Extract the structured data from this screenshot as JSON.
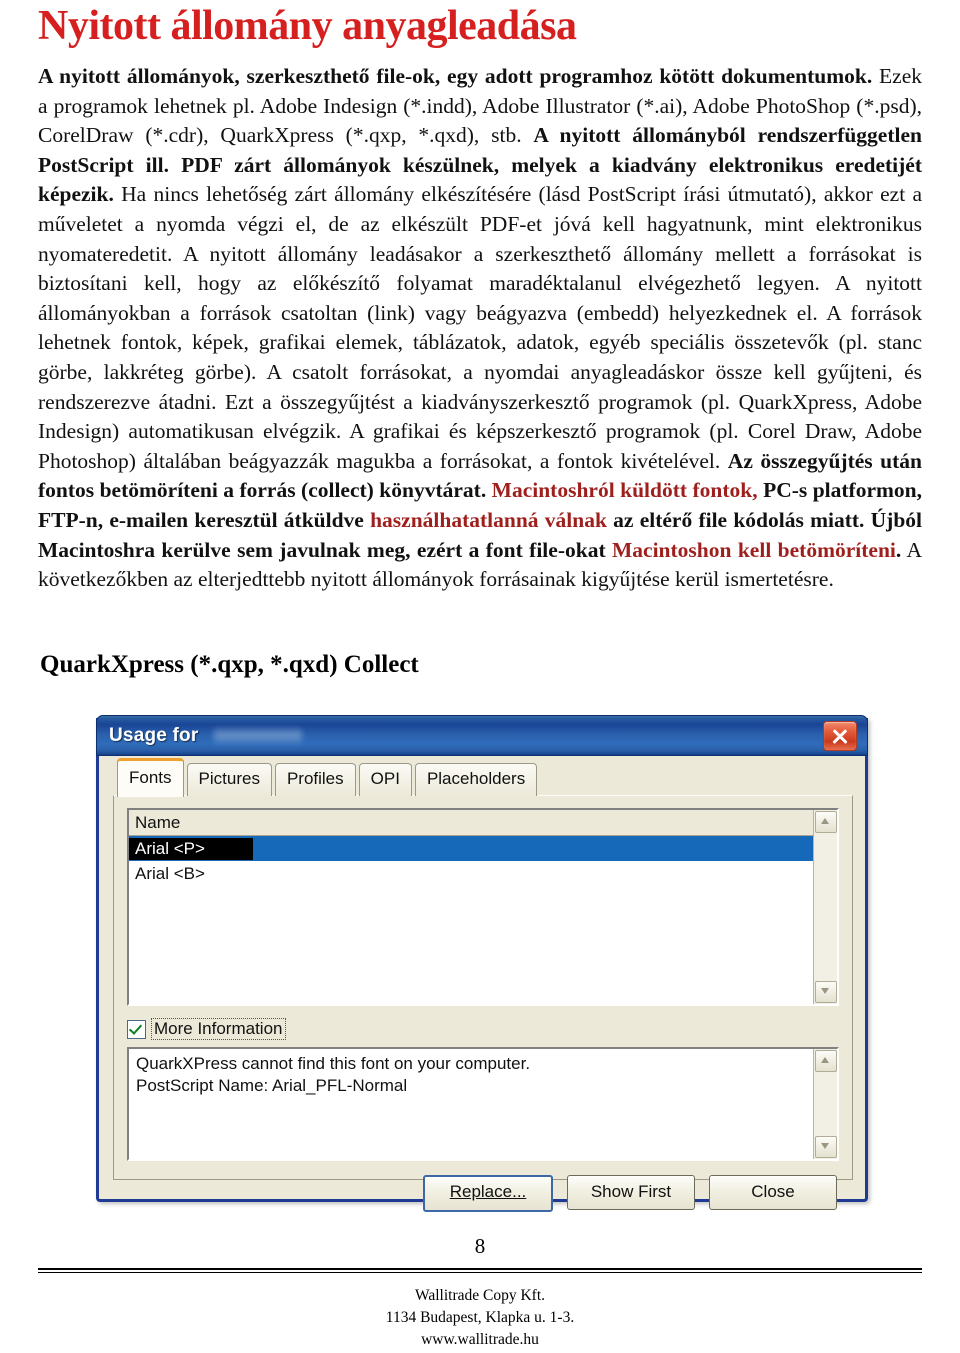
{
  "document": {
    "title": "Nyitott állomány anyagleadása",
    "title_color": "#d61f1f",
    "accent_red": "#9e1f1c",
    "sub_heading": "QuarkXpress (*.qxp, *.qxd) Collect",
    "body": {
      "p1_bold_lead": "A nyitott állományok, szerkeszthető file-ok, egy adott programhoz kötött dokumentumok.",
      "p1_part2": " Ezek a programok lehetnek pl. Adobe Indesign (*.indd), Adobe Illustrator (*.ai), Adobe PhotoShop (*.psd), CorelDraw (*.cdr), QuarkXpress (*.qxp, *.qxd), stb. ",
      "p1_bold2": "A nyitott állományból rendszerfüggetlen PostScript ill. PDF zárt állományok készülnek, melyek a kiadvány elektronikus eredetijét képezik.",
      "p1_part3": " Ha nincs lehetőség zárt állomány elkészítésére (lásd PostScript írási útmutató), akkor ezt a műveletet a nyomda végzi el, de az elkészült PDF-et jóvá kell hagyatnunk, mint elektronikus nyomateredetit. A nyitott állomány leadásakor a szerkeszthető állomány mellett a forrásokat is biztosítani kell, hogy az előkészítő folyamat maradéktalanul elvégezhető legyen. A nyitott állományokban a források csatoltan (link) vagy beágyazva (embedd) helyezkednek el. A források lehetnek fontok, képek, grafikai elemek, táblázatok, adatok, egyéb speciális összetevők (pl. stanc görbe, lakkréteg görbe). A csatolt forrásokat, a nyomdai anyagleadáskor össze kell gyűjteni, és rendszerezve átadni. Ezt a összegyűjtést a kiadványszerkesztő programok (pl. QuarkXpress, Adobe Indesign) automatikusan elvégzik. A grafikai és képszerkesztő programok (pl. Corel Draw, Adobe Photoshop) általában beágyazzák magukba a forrásokat, a fontok kivételével. ",
      "p1_bold3": "Az összegyűjtés után fontos betömöríteni a forrás (collect) könyvtárat.",
      "p1_red1": " Macintoshról küldött fontok,",
      "p1_bold4": " PC-s platformon, FTP-n, e-mailen keresztül átküldve ",
      "p1_red2": "használhatatlanná válnak",
      "p1_bold5": " az eltérő file kódolás miatt. Újból Macintoshra kerülve sem javulnak meg, ezért a font file-okat ",
      "p1_red3": "Macintoshon kell betömöríteni",
      "p1_bold6": ".",
      "p1_part4": " A következőkben az elterjedttebb nyitott állományok forrásainak kigyűjtése kerül ismertetésre."
    }
  },
  "dialog": {
    "title": "Usage for",
    "title_suffix_redacted": "",
    "close_icon": "close-icon",
    "tabs": [
      {
        "label": "Fonts",
        "active": true
      },
      {
        "label": "Pictures",
        "active": false
      },
      {
        "label": "Profiles",
        "active": false
      },
      {
        "label": "OPI",
        "active": false
      },
      {
        "label": "Placeholders",
        "active": false
      }
    ],
    "list": {
      "column_header": "Name",
      "rows": [
        {
          "name": "Arial <P>",
          "selected": true
        },
        {
          "name": "Arial <B>",
          "selected": false
        }
      ]
    },
    "more_information": {
      "label": "More Information",
      "checked": true
    },
    "info_lines": [
      "QuarkXPress cannot find this font on your computer.",
      "PostScript Name:  Arial_PFL-Normal"
    ],
    "buttons": [
      {
        "label": "Replace...",
        "accesskey": "R",
        "default": true
      },
      {
        "label": "Show First",
        "default": false
      },
      {
        "label": "Close",
        "default": false
      }
    ]
  },
  "footer": {
    "page_number": "8",
    "company": "Wallitrade Copy Kft.",
    "address": "1134 Budapest, Klapka u. 1-3.",
    "website": "www.wallitrade.hu"
  }
}
